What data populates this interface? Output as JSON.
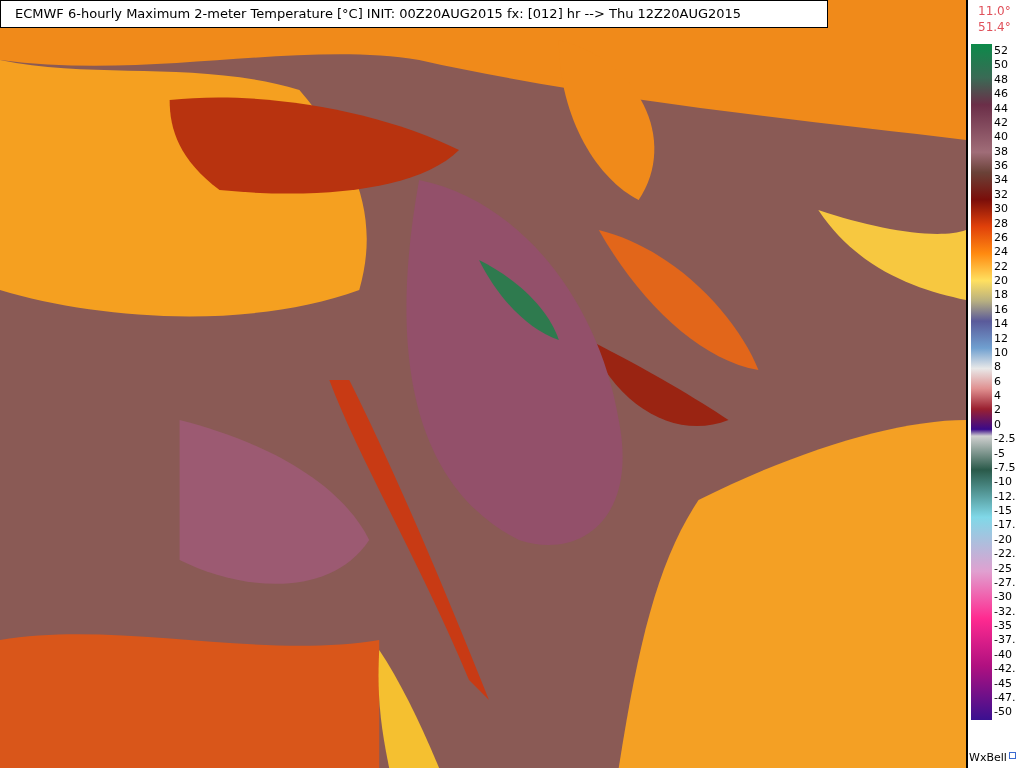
{
  "title": "ECMWF 6-hourly Maximum 2-meter Temperature [°C] INIT: 00Z20AUG2015 fx: [012] hr --> Thu 12Z20AUG2015",
  "range": {
    "min": "11.0°",
    "max": "51.4°"
  },
  "legend": {
    "labels": [
      "52",
      "50",
      "48",
      "46",
      "44",
      "42",
      "40",
      "38",
      "36",
      "34",
      "32",
      "30",
      "28",
      "26",
      "24",
      "22",
      "20",
      "18",
      "16",
      "14",
      "12",
      "10",
      "8",
      "6",
      "4",
      "2",
      "0",
      "-2.5",
      "-5",
      "-7.5",
      "-10",
      "-12.",
      "-15",
      "-17.",
      "-20",
      "-22.",
      "-25",
      "-27.",
      "-30",
      "-32.",
      "-35",
      "-37.",
      "-40",
      "-42.",
      "-45",
      "-47.",
      "-50"
    ]
  },
  "credit": "WxBell"
}
